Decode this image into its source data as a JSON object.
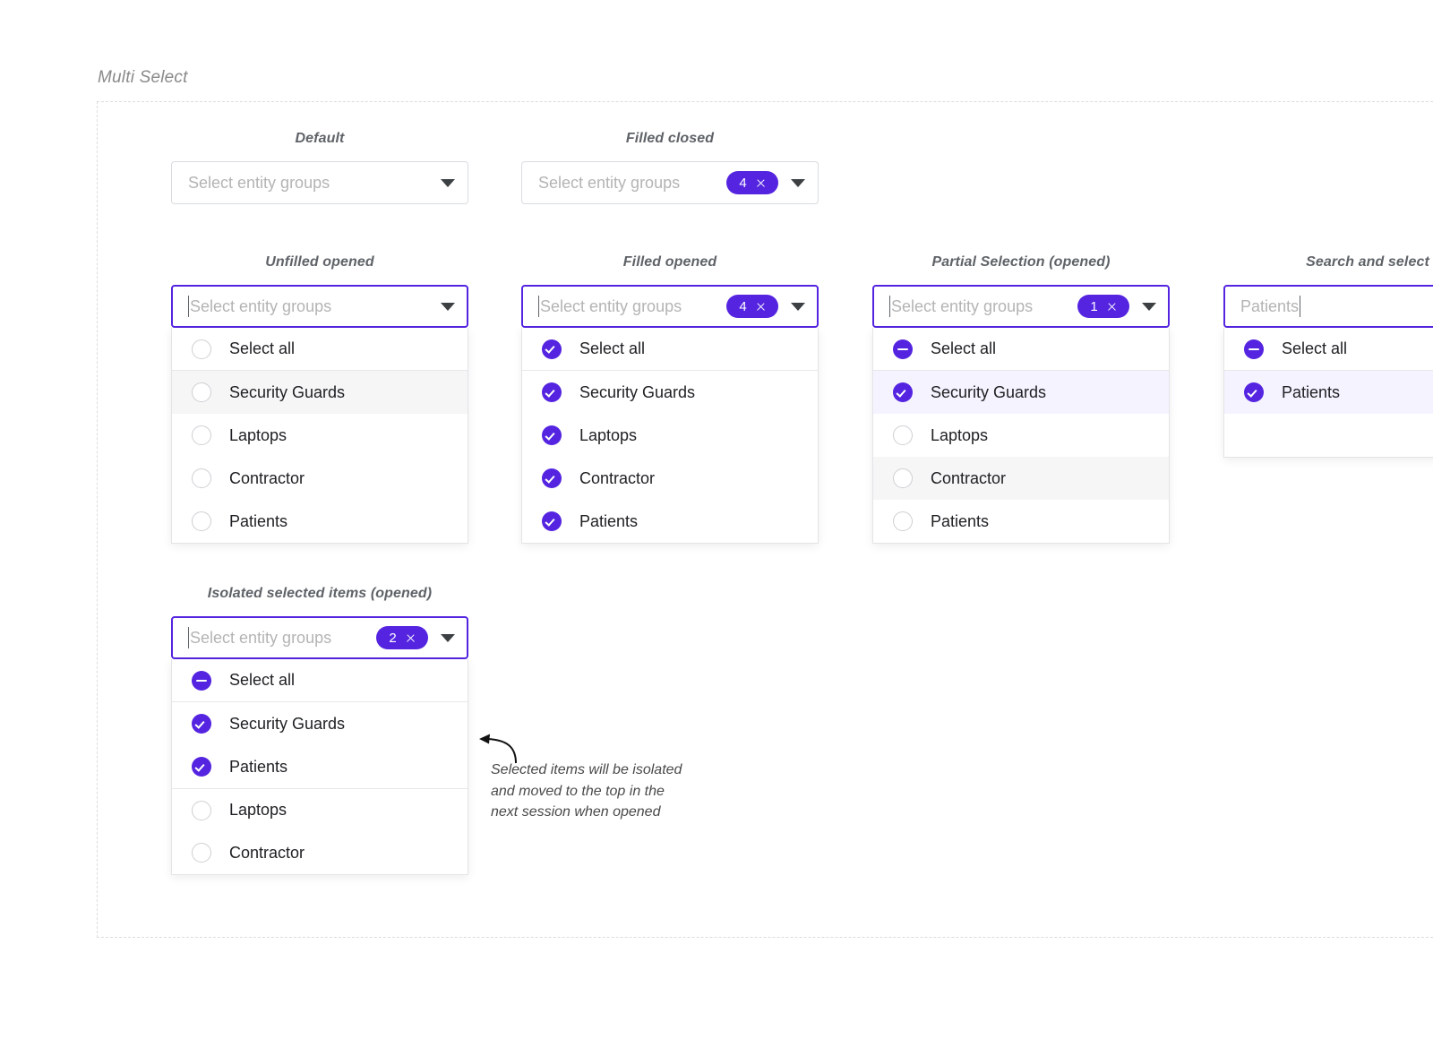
{
  "section": {
    "title": "Multi Select"
  },
  "placeholder": "Select entity groups",
  "colors": {
    "accent": "#5424e0",
    "field_border": "#dadce0",
    "focus_border": "#5424e0",
    "row_hover": "#f6f6f7",
    "row_selected": "#f5f3ff",
    "placeholder_text": "#b4b4b4",
    "option_text": "#202124",
    "label_text": "#5f6368",
    "frame_dash": "#dcdcdc"
  },
  "icons": {
    "chevron": "chevron-down-icon",
    "badge_close": "close-icon",
    "checkbox_checked": "checkbox-checked-icon",
    "checkbox_unchecked": "checkbox-unchecked-icon",
    "checkbox_indeterminate": "checkbox-indeterminate-icon"
  },
  "variants": {
    "default": {
      "label": "Default",
      "placeholder": "Select entity groups",
      "badge": null
    },
    "filled_closed": {
      "label": "Filled closed",
      "placeholder": "Select entity groups",
      "badge": {
        "count": "4",
        "close": "×"
      }
    },
    "unfilled_opened": {
      "label": "Unfilled opened",
      "placeholder": "Select entity groups",
      "badge": null,
      "options": [
        {
          "label": "Select all",
          "state": "unchecked",
          "row": "normal"
        },
        {
          "label": "Security Guards",
          "state": "unchecked",
          "row": "hovered"
        },
        {
          "label": "Laptops",
          "state": "unchecked",
          "row": "normal"
        },
        {
          "label": "Contractor",
          "state": "unchecked",
          "row": "normal"
        },
        {
          "label": "Patients",
          "state": "unchecked",
          "row": "normal"
        }
      ]
    },
    "filled_opened": {
      "label": "Filled opened",
      "placeholder": "Select entity groups",
      "badge": {
        "count": "4",
        "close": "×"
      },
      "options": [
        {
          "label": "Select all",
          "state": "checked",
          "row": "normal"
        },
        {
          "label": "Security Guards",
          "state": "checked",
          "row": "normal"
        },
        {
          "label": "Laptops",
          "state": "checked",
          "row": "normal"
        },
        {
          "label": "Contractor",
          "state": "checked",
          "row": "normal"
        },
        {
          "label": "Patients",
          "state": "checked",
          "row": "normal"
        }
      ]
    },
    "partial_selection": {
      "label": "Partial Selection (opened)",
      "placeholder": "Select entity groups",
      "badge": {
        "count": "1",
        "close": "×"
      },
      "options": [
        {
          "label": "Select all",
          "state": "indeterminate",
          "row": "normal"
        },
        {
          "label": "Security Guards",
          "state": "checked",
          "row": "row-selected"
        },
        {
          "label": "Laptops",
          "state": "unchecked",
          "row": "normal"
        },
        {
          "label": "Contractor",
          "state": "unchecked",
          "row": "hovered"
        },
        {
          "label": "Patients",
          "state": "unchecked",
          "row": "normal"
        }
      ]
    },
    "search_and_select": {
      "label": "Search and select (",
      "typed_value": "Patients",
      "badge": null,
      "options": [
        {
          "label": "Select all",
          "state": "indeterminate",
          "row": "normal"
        },
        {
          "label": "Patients",
          "state": "checked",
          "row": "row-selected"
        }
      ]
    },
    "isolated_selected": {
      "label": "Isolated selected items (opened)",
      "placeholder": "Select entity groups",
      "badge": {
        "count": "2",
        "close": "×"
      },
      "options": [
        {
          "label": "Select all",
          "state": "indeterminate",
          "row": "normal",
          "group": "header"
        },
        {
          "label": "Security Guards",
          "state": "checked",
          "row": "normal",
          "group": "selected"
        },
        {
          "label": "Patients",
          "state": "checked",
          "row": "normal",
          "group": "selected"
        },
        {
          "label": "Laptops",
          "state": "unchecked",
          "row": "normal",
          "group": "unselected-first"
        },
        {
          "label": "Contractor",
          "state": "unchecked",
          "row": "normal",
          "group": "unselected"
        }
      ]
    }
  },
  "annotation": {
    "line1": "Selected items will be isolated",
    "line2": "and moved to the top in the",
    "line3": "next session when opened"
  }
}
